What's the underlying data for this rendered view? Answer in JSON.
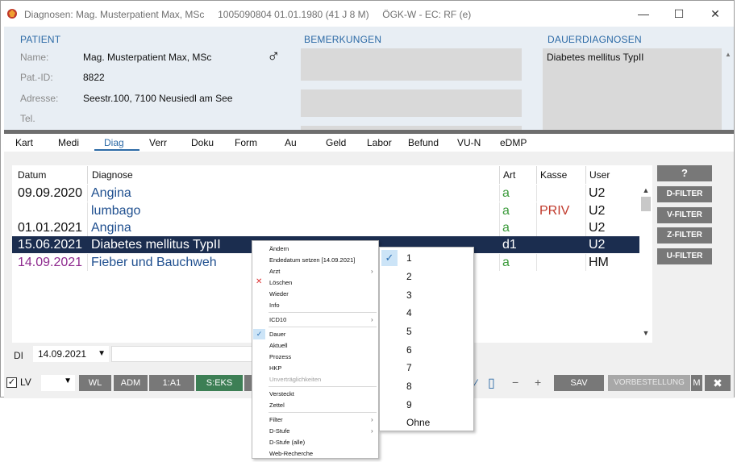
{
  "window": {
    "title": "Diagnosen: Mag. Musterpatient Max, MSc     1005090804 01.01.1980 (41 J 8 M)     ÖGK-W - EC: RF (e)",
    "minimize": "—",
    "maximize": "☐",
    "close": "✕"
  },
  "patient": {
    "section_title": "PATIENT",
    "name_label": "Name:",
    "name_value": "Mag. Musterpatient Max, MSc",
    "patid_label": "Pat.-ID:",
    "patid_value": "8822",
    "address_label": "Adresse:",
    "address_value": "Seestr.100, 7100 Neusiedl am See",
    "tel_label": "Tel.",
    "gender_symbol": "♂"
  },
  "bemerkungen": {
    "section_title": "BEMERKUNGEN"
  },
  "dauerdiagnosen": {
    "section_title": "DAUERDIAGNOSEN",
    "text": "Diabetes mellitus TypII"
  },
  "tabs": [
    "Kart",
    "Medi",
    "Diag",
    "Verr",
    "Doku",
    "Form",
    "Au",
    "Geld",
    "Labor",
    "Befund",
    "VU-N",
    "eDMP"
  ],
  "active_tab": "Diag",
  "table": {
    "headers": [
      "Datum",
      "Diagnose",
      "Art",
      "Kasse",
      "User"
    ],
    "rows": [
      {
        "datum": "09.09.2020",
        "diagnose": "Angina",
        "art": "a",
        "kasse": "",
        "user": "U2"
      },
      {
        "datum": "",
        "diagnose": "lumbago",
        "art": "a",
        "kasse": "PRIV",
        "user": "U2"
      },
      {
        "datum": "01.01.2021",
        "diagnose": "Angina",
        "art": "a",
        "kasse": "",
        "user": "U2"
      },
      {
        "datum": "15.06.2021",
        "diagnose": "Diabetes mellitus TypII",
        "art": "d1",
        "kasse": "",
        "user": "U2"
      },
      {
        "datum": "14.09.2021",
        "diagnose": "Fieber und Bauchweh",
        "art": "a",
        "kasse": "",
        "user": "HM"
      }
    ],
    "selected_row": 3
  },
  "right_buttons": {
    "help": "?",
    "d_filter": "D-FILTER",
    "v_filter": "V-FILTER",
    "z_filter": "Z-FILTER",
    "u_filter": "U-FILTER"
  },
  "di": {
    "label": "DI",
    "date": "14.09.2021"
  },
  "bottom": {
    "lv_label": "LV",
    "lv_checked": "✓",
    "buttons": [
      "WL",
      "ADM",
      "1:A1",
      "S:EKS"
    ],
    "sav": "SAV",
    "vorbestellung": "VORBESTELLUNG",
    "m": "M",
    "close": "✖"
  },
  "context_menu": {
    "items": [
      {
        "label": "Ändern"
      },
      {
        "label": "Endedatum setzen [14.09.2021]"
      },
      {
        "label": "Arzt",
        "submenu": true
      },
      {
        "label": "Löschen",
        "icon": "delete-x-icon"
      },
      {
        "label": "Wieder"
      },
      {
        "label": "Info"
      },
      {
        "label": "ICD10",
        "submenu": true
      },
      {
        "label": "Dauer",
        "checked": true
      },
      {
        "label": "Aktuell"
      },
      {
        "label": "Prozess"
      },
      {
        "label": "HKP"
      },
      {
        "label": "Unverträglichkeiten",
        "disabled": true
      },
      {
        "label": "Versteckt"
      },
      {
        "label": "Zettel"
      },
      {
        "label": "Filter",
        "submenu": true
      },
      {
        "label": "D-Stufe",
        "submenu": true
      },
      {
        "label": "D-Stufe (alle)"
      },
      {
        "label": "Web-Recherche"
      }
    ]
  },
  "submenu": {
    "items": [
      "1",
      "2",
      "3",
      "4",
      "5",
      "6",
      "7",
      "8",
      "9",
      "Ohne"
    ],
    "checked": "1"
  },
  "colors": {
    "accent_blue": "#2c6aa6",
    "selection": "#1b2d4f",
    "art_green": "#3a9a3a",
    "priv_red": "#c0392b",
    "purple_date": "#8e2a8e",
    "button_gray": "#787878",
    "button_green": "#3d7f55"
  }
}
